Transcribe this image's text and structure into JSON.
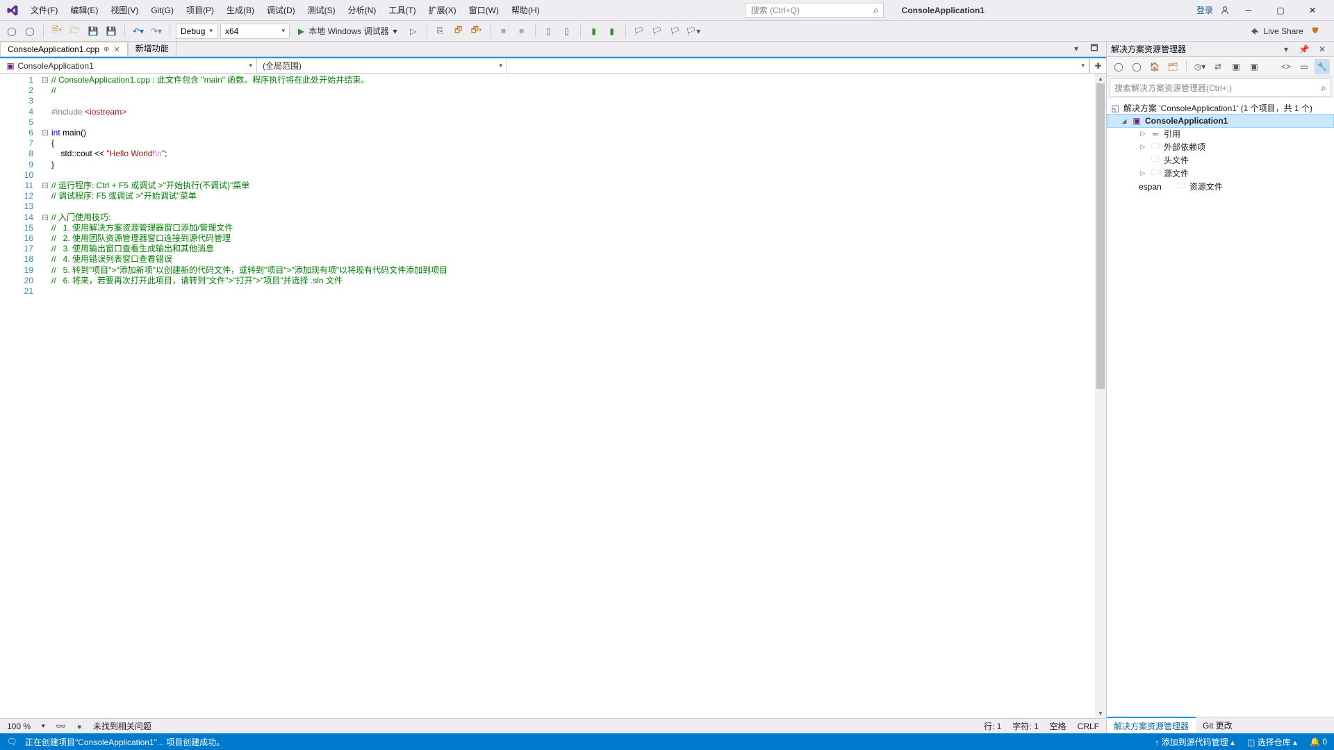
{
  "menubar": {
    "items": [
      "文件(F)",
      "编辑(E)",
      "视图(V)",
      "Git(G)",
      "项目(P)",
      "生成(B)",
      "调试(D)",
      "测试(S)",
      "分析(N)",
      "工具(T)",
      "扩展(X)",
      "窗口(W)",
      "帮助(H)"
    ],
    "search_placeholder": "搜索 (Ctrl+Q)",
    "app_title": "ConsoleApplication1",
    "login": "登录"
  },
  "toolbar": {
    "config": "Debug",
    "platform": "x64",
    "run_label": "本地 Windows 调试器",
    "liveshare": "Live Share"
  },
  "tabs": {
    "active": "ConsoleApplication1.cpp",
    "other": "新增功能"
  },
  "nav": {
    "scope1": "ConsoleApplication1",
    "scope2": "(全局范围)",
    "scope3": ""
  },
  "code": {
    "lines": [
      {
        "n": 1,
        "fold": "⊟",
        "html": "<span class='c-comment'>// ConsoleApplication1.cpp : 此文件包含 \"main\" 函数。程序执行将在此处开始并结束。</span>"
      },
      {
        "n": 2,
        "fold": "",
        "html": "<span class='c-comment'>//</span>"
      },
      {
        "n": 3,
        "fold": "",
        "html": ""
      },
      {
        "n": 4,
        "fold": "",
        "html": "<span class='c-pre'>#include </span><span class='c-inc'>&lt;iostream&gt;</span>"
      },
      {
        "n": 5,
        "fold": "",
        "html": ""
      },
      {
        "n": 6,
        "fold": "⊟",
        "html": "<span class='c-kw'>int</span> main()"
      },
      {
        "n": 7,
        "fold": "",
        "html": "{"
      },
      {
        "n": 8,
        "fold": "",
        "html": "    std::cout &lt;&lt; <span class='c-str'>\"Hello World!</span><span class='c-esc'>\\n</span><span class='c-str'>\"</span>;"
      },
      {
        "n": 9,
        "fold": "",
        "html": "}"
      },
      {
        "n": 10,
        "fold": "",
        "html": ""
      },
      {
        "n": 11,
        "fold": "⊟",
        "html": "<span class='c-comment'>// 运行程序: Ctrl + F5 或调试 &gt;\"开始执行(不调试)\"菜单</span>"
      },
      {
        "n": 12,
        "fold": "",
        "html": "<span class='c-comment'>// 调试程序: F5 或调试 &gt;\"开始调试\"菜单</span>"
      },
      {
        "n": 13,
        "fold": "",
        "html": ""
      },
      {
        "n": 14,
        "fold": "⊟",
        "html": "<span class='c-comment'>// 入门使用技巧: </span>"
      },
      {
        "n": 15,
        "fold": "",
        "html": "<span class='c-comment'>//   1. 使用解决方案资源管理器窗口添加/管理文件</span>"
      },
      {
        "n": 16,
        "fold": "",
        "html": "<span class='c-comment'>//   2. 使用团队资源管理器窗口连接到源代码管理</span>"
      },
      {
        "n": 17,
        "fold": "",
        "html": "<span class='c-comment'>//   3. 使用输出窗口查看生成输出和其他消息</span>"
      },
      {
        "n": 18,
        "fold": "",
        "html": "<span class='c-comment'>//   4. 使用错误列表窗口查看错误</span>"
      },
      {
        "n": 19,
        "fold": "",
        "html": "<span class='c-comment'>//   5. 转到\"项目\"&gt;\"添加新项\"以创建新的代码文件，或转到\"项目\"&gt;\"添加现有项\"以将现有代码文件添加到项目</span>"
      },
      {
        "n": 20,
        "fold": "",
        "html": "<span class='c-comment'>//   6. 将来，若要再次打开此项目，请转到\"文件\"&gt;\"打开\"&gt;\"项目\"并选择 .sln 文件</span>"
      },
      {
        "n": 21,
        "fold": "",
        "html": ""
      }
    ]
  },
  "editor_status": {
    "zoom": "100 %",
    "issues": "未找到相关问题",
    "line": "行: 1",
    "char": "字符: 1",
    "spaces": "空格",
    "enc": "CRLF"
  },
  "solution": {
    "title": "解决方案资源管理器",
    "search_placeholder": "搜索解决方案资源管理器(Ctrl+;)",
    "root": "解决方案 'ConsoleApplication1' (1 个项目，共 1 个)",
    "project": "ConsoleApplication1",
    "items": [
      "引用",
      "外部依赖项",
      "头文件",
      "源文件",
      "资源文件"
    ],
    "tabs": [
      "解决方案资源管理器",
      "Git 更改"
    ]
  },
  "status_bar": {
    "msg": "正在创建项目\"ConsoleApplication1\"... 项目创建成功。",
    "scm": "添加到源代码管理",
    "repo": "选择仓库",
    "notif": "0"
  }
}
